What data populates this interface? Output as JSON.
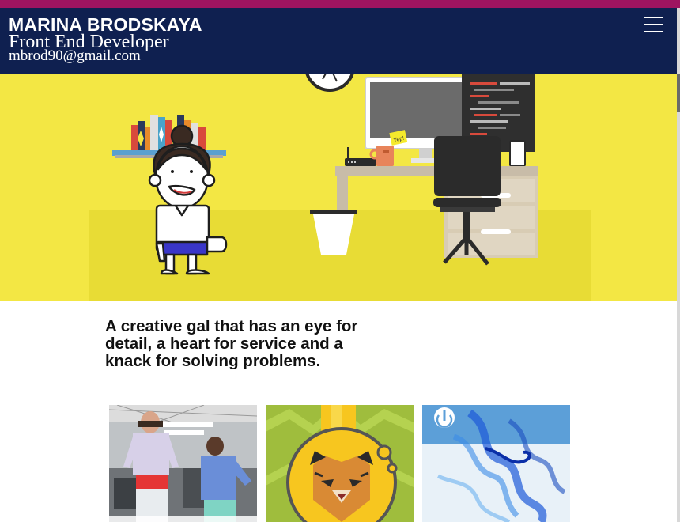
{
  "header": {
    "name": "MARINA BRODSKAYA",
    "role": "Front End Developer",
    "email": "mbrod90@gmail.com"
  },
  "hero": {
    "sticky_note": "Yep!"
  },
  "tagline": "A creative gal that has an eye for detail, a heart for service and a knack for solving problems.",
  "colors": {
    "accent_stripe": "#9e1460",
    "navbar": "#0f2050",
    "hero_wall": "#f3e744",
    "hero_floor": "#e8dc35"
  }
}
